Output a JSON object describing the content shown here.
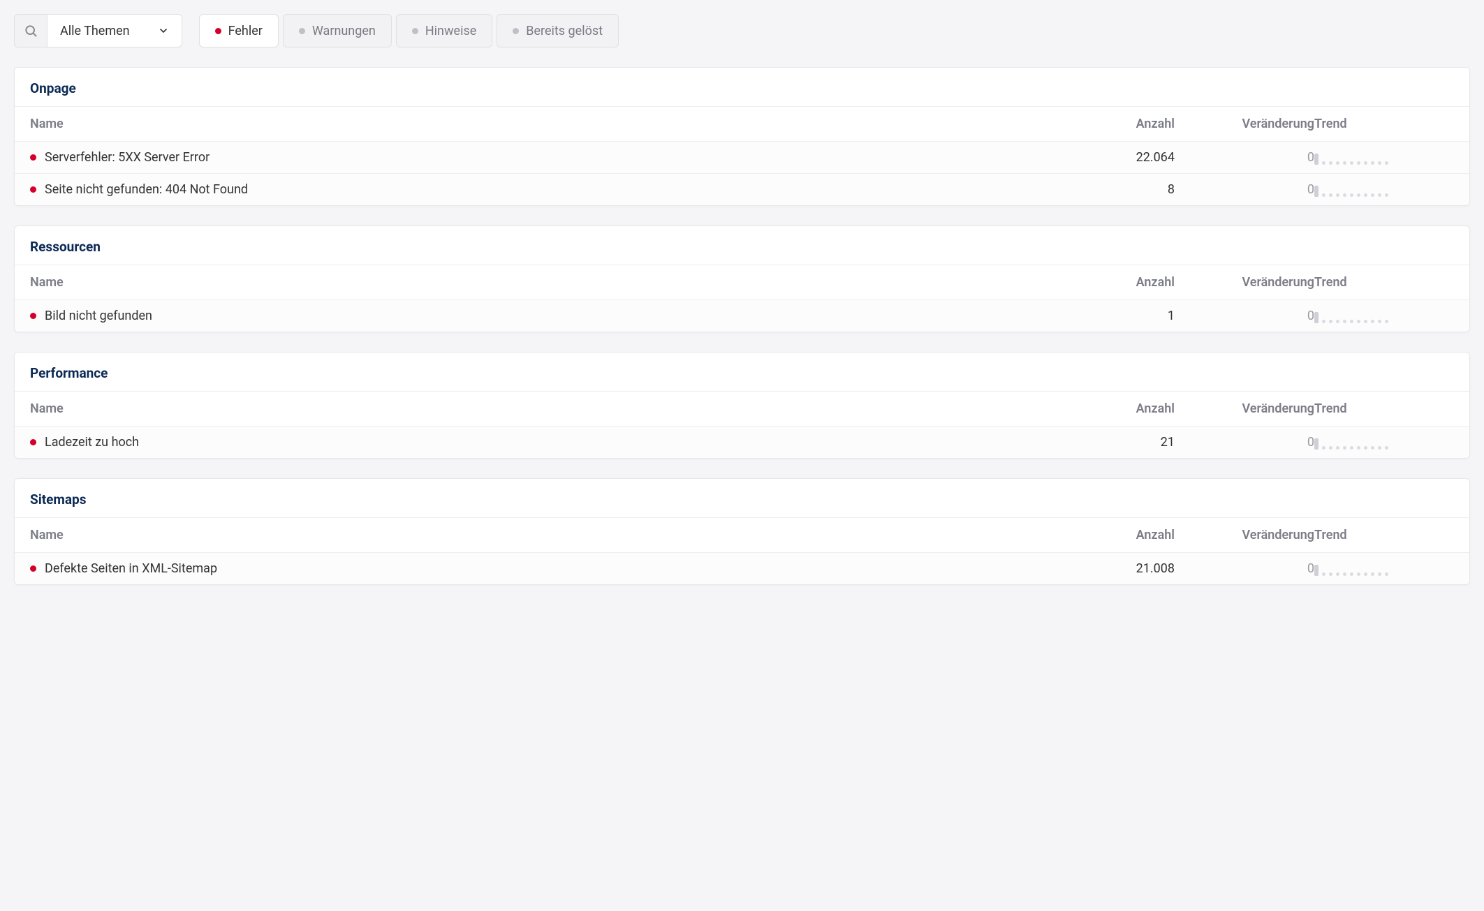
{
  "toolbar": {
    "dropdown_label": "Alle Themen"
  },
  "tabs": [
    {
      "label": "Fehler",
      "active": true,
      "red": true
    },
    {
      "label": "Warnungen",
      "active": false,
      "red": false
    },
    {
      "label": "Hinweise",
      "active": false,
      "red": false
    },
    {
      "label": "Bereits gelöst",
      "active": false,
      "red": false
    }
  ],
  "columns": {
    "name": "Name",
    "count": "Anzahl",
    "change": "Veränderung",
    "trend": "Trend"
  },
  "sections": [
    {
      "title": "Onpage",
      "rows": [
        {
          "name": "Serverfehler: 5XX Server Error",
          "count": "22.064",
          "change": "0"
        },
        {
          "name": "Seite nicht gefunden: 404 Not Found",
          "count": "8",
          "change": "0"
        }
      ]
    },
    {
      "title": "Ressourcen",
      "rows": [
        {
          "name": "Bild nicht gefunden",
          "count": "1",
          "change": "0"
        }
      ]
    },
    {
      "title": "Performance",
      "rows": [
        {
          "name": "Ladezeit zu hoch",
          "count": "21",
          "change": "0"
        }
      ]
    },
    {
      "title": "Sitemaps",
      "rows": [
        {
          "name": "Defekte Seiten in XML-Sitemap",
          "count": "21.008",
          "change": "0"
        }
      ]
    }
  ]
}
